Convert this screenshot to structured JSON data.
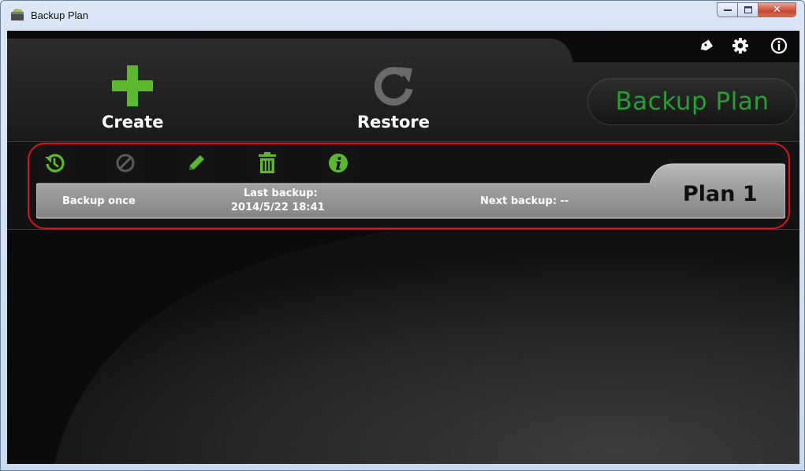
{
  "window": {
    "title": "Backup Plan"
  },
  "colors": {
    "accent_green": "#2a9e32",
    "icon_green": "#5cb82f",
    "highlight_red": "#e0121a"
  },
  "topbar": {
    "icons": [
      "tag-icon",
      "gear-icon",
      "info-icon"
    ]
  },
  "actions": {
    "create_label": "Create",
    "restore_label": "Restore"
  },
  "brand": {
    "label": "Backup Plan"
  },
  "toolbar": {
    "icons": [
      "history-icon",
      "disable-icon",
      "edit-icon",
      "delete-icon",
      "info-icon"
    ]
  },
  "plan": {
    "name": "Plan 1",
    "schedule": "Backup once",
    "last_backup_label": "Last backup:",
    "last_backup_value": "2014/5/22 18:41",
    "next_backup": "Next backup: --"
  }
}
